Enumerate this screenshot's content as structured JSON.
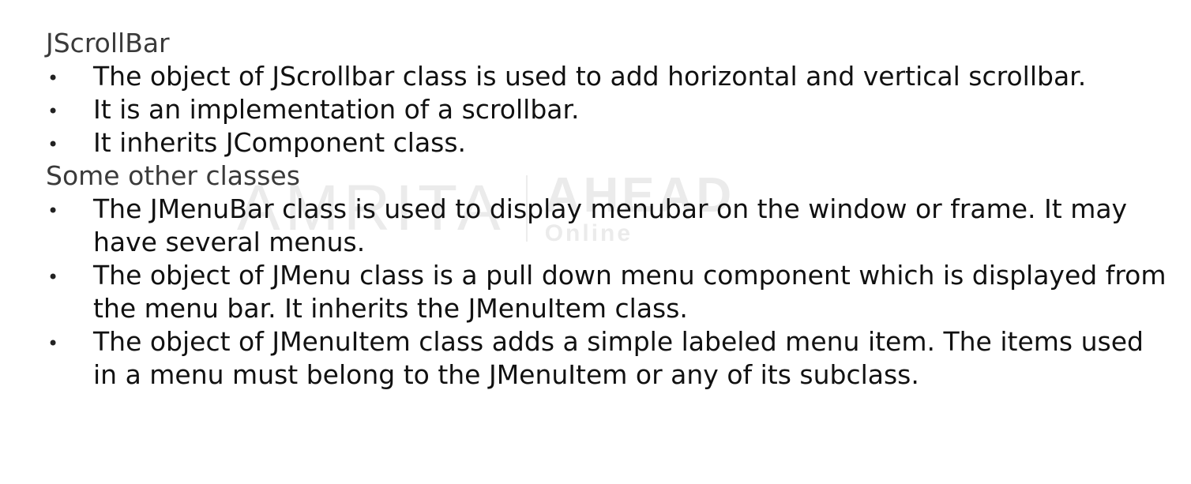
{
  "watermark": {
    "main": "AMRITA",
    "ahead": "AHEAD",
    "online": "Online"
  },
  "sections": [
    {
      "heading": "JScrollBar",
      "bullets": [
        "The object of JScrollbar class is used to add horizontal and vertical scrollbar.",
        "It is an implementation of a scrollbar.",
        "It inherits JComponent class."
      ]
    },
    {
      "heading": "Some other classes",
      "bullets": [
        "The JMenuBar class is used to display menubar on the window or frame. It may have several menus.",
        "The object of JMenu class is a pull down menu component which is displayed from the menu bar. It inherits the JMenuItem class.",
        "The object of JMenuItem class adds a simple labeled menu item. The items used in a menu must belong to the JMenuItem or any of its subclass."
      ]
    }
  ],
  "bullet_glyph": "•"
}
